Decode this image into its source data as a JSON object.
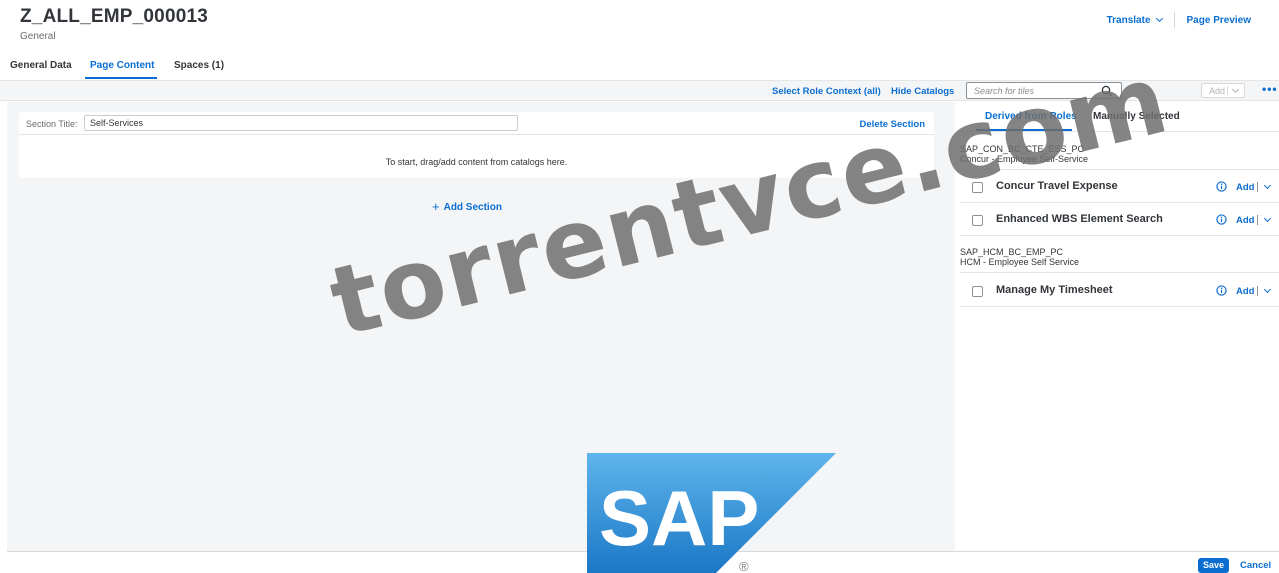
{
  "header": {
    "title": "Z_ALL_EMP_000013",
    "subtitle": "General",
    "translate_label": "Translate",
    "page_preview_label": "Page Preview"
  },
  "tabs": [
    {
      "label": "General Data",
      "active": false
    },
    {
      "label": "Page Content",
      "active": true
    },
    {
      "label": "Spaces (1)",
      "active": false
    }
  ],
  "toolbar": {
    "select_role_context_label": "Select Role Context (all)",
    "hide_catalogs_label": "Hide Catalogs"
  },
  "catalog_toolbar": {
    "search_placeholder": "Search for tiles",
    "add_label": "Add"
  },
  "section": {
    "title_label": "Section Title:",
    "title_value": "Self-Services",
    "delete_label": "Delete Section",
    "drop_hint": "To start, drag/add content from catalogs here.",
    "add_section_label": "Add Section"
  },
  "catalog_panel": {
    "tabs": [
      {
        "label": "Derived from Roles",
        "active": true
      },
      {
        "label": "Manually Selected",
        "active": false
      }
    ],
    "groups": [
      {
        "role_id": "SAP_CON_BC_CTE_ESS_PC",
        "role_name": "Concur - Employee Self-Service",
        "tiles": [
          {
            "name": "Concur Travel Expense",
            "add_label": "Add"
          },
          {
            "name": "Enhanced WBS Element Search",
            "add_label": "Add"
          }
        ]
      },
      {
        "role_id": "SAP_HCM_BC_EMP_PC",
        "role_name": "HCM - Employee Self Service",
        "tiles": [
          {
            "name": "Manage My Timesheet",
            "add_label": "Add"
          }
        ]
      }
    ]
  },
  "footer": {
    "save_label": "Save",
    "cancel_label": "Cancel"
  },
  "watermark_text": "torrentvce.com",
  "logo": {
    "text": "SAP",
    "registered_mark": "®"
  },
  "colors": {
    "accent": "#0a6ed1",
    "text": "#32363a",
    "muted": "#6a6d70",
    "background_gray": "#f4f5f6"
  }
}
